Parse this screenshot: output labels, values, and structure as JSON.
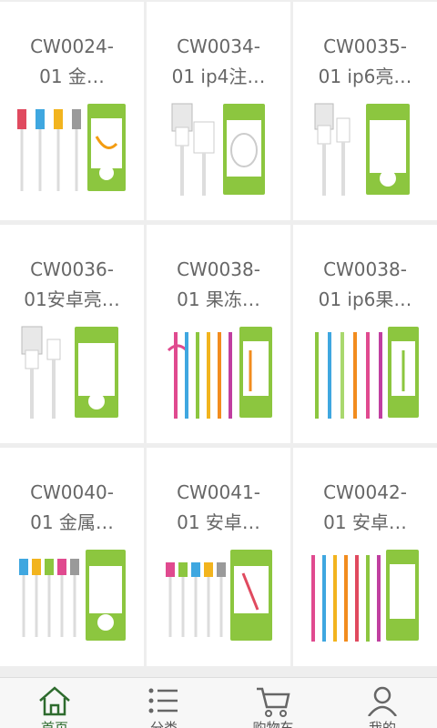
{
  "products": [
    {
      "line1": "CW0024-",
      "line2": "01 金…",
      "image": "usb-cable-set-image"
    },
    {
      "line1": "CW0034-",
      "line2": "01 ip4注…",
      "image": "ip4-cable-image"
    },
    {
      "line1": "CW0035-",
      "line2": "01 ip6亮…",
      "image": "ip6-cable-image"
    },
    {
      "line1": "CW0036-",
      "line2": "01安卓亮…",
      "image": "android-cable-image"
    },
    {
      "line1": "CW0038-",
      "line2": "01 果冻…",
      "image": "jelly-cable-image"
    },
    {
      "line1": "CW0038-",
      "line2": "01 ip6果…",
      "image": "ip6-jelly-cable-image"
    },
    {
      "line1": "CW0040-",
      "line2": "01 金属…",
      "image": "metal-cable-image"
    },
    {
      "line1": "CW0041-",
      "line2": "01 安卓…",
      "image": "android-cable-set-image"
    },
    {
      "line1": "CW0042-",
      "line2": "01 安卓…",
      "image": "android-flat-cable-image"
    }
  ],
  "tabbar": {
    "home": "首页",
    "category": "分类",
    "cart": "购物车",
    "mine": "我的"
  },
  "colors": {
    "active_tab": "#2e6b2e",
    "card_bg": "#ffffff",
    "page_bg": "#eeeeee",
    "package_green": "#8cc63f"
  }
}
